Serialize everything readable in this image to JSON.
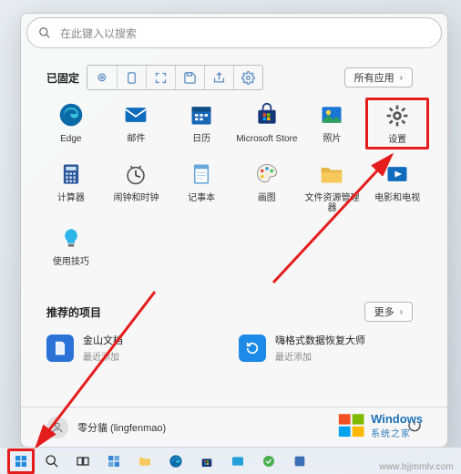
{
  "search": {
    "placeholder": "在此键入以搜索"
  },
  "sections": {
    "pinned_title": "已固定",
    "all_apps_label": "所有应用",
    "recommended_title": "推荐的项目",
    "more_label": "更多"
  },
  "pinned_apps": {
    "row1": [
      {
        "label": "Edge"
      },
      {
        "label": "邮件"
      },
      {
        "label": "日历"
      },
      {
        "label": "Microsoft Store"
      },
      {
        "label": "照片"
      },
      {
        "label": "设置"
      }
    ],
    "row2": [
      {
        "label": "计算器"
      },
      {
        "label": "闹钟和时钟"
      },
      {
        "label": "记事本"
      },
      {
        "label": "画图"
      },
      {
        "label": "文件资源管理器"
      },
      {
        "label": "电影和电视"
      }
    ],
    "row3": [
      {
        "label": "使用技巧"
      }
    ]
  },
  "recommended": [
    {
      "title": "金山文档",
      "subtitle": "最近添加"
    },
    {
      "title": "嗨格式数据恢复大师",
      "subtitle": "最近添加"
    }
  ],
  "user": {
    "display": "零分貓 (lingfenmao)"
  },
  "watermark": {
    "brand": "Windows",
    "brand_sub": "系统之家",
    "url": "www.bjjmmlv.com"
  }
}
